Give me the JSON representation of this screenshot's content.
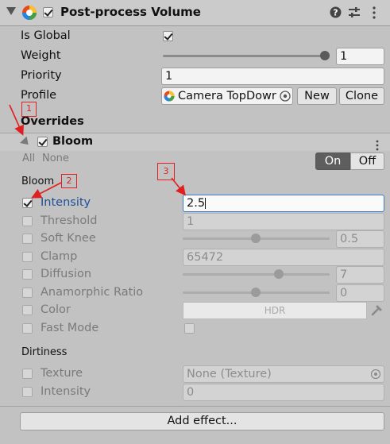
{
  "component": {
    "title": "Post-process Volume",
    "enabled": true
  },
  "fields": {
    "is_global": {
      "label": "Is Global",
      "checked": true
    },
    "weight": {
      "label": "Weight",
      "value": "1",
      "fraction": 1.0
    },
    "priority": {
      "label": "Priority",
      "value": "1"
    },
    "profile": {
      "label": "Profile",
      "value": "Camera TopDowr",
      "new_label": "New",
      "clone_label": "Clone"
    }
  },
  "overrides": {
    "label": "Overrides",
    "effect": {
      "name": "Bloom",
      "enabled": true,
      "all_label": "All",
      "none_label": "None",
      "on_label": "On",
      "off_label": "Off",
      "toggle_state": "On"
    },
    "bloom_section": "Bloom",
    "intensity": {
      "label": "Intensity",
      "value": "2.5",
      "checked": true
    },
    "threshold": {
      "label": "Threshold",
      "value": "1"
    },
    "soft_knee": {
      "label": "Soft Knee",
      "value": "0.5",
      "fraction": 0.5
    },
    "clamp": {
      "label": "Clamp",
      "value": "65472"
    },
    "diffusion": {
      "label": "Diffusion",
      "value": "7",
      "fraction": 0.65
    },
    "anamorphic_ratio": {
      "label": "Anamorphic Ratio",
      "value": "0",
      "fraction": 0.5
    },
    "color": {
      "label": "Color",
      "value": "HDR"
    },
    "fast_mode": {
      "label": "Fast Mode"
    },
    "dirtiness_section": "Dirtiness",
    "texture": {
      "label": "Texture",
      "value": "None (Texture)"
    },
    "dirt_intensity": {
      "label": "Intensity",
      "value": "0"
    }
  },
  "add_effect_label": "Add effect...",
  "annotations": [
    "1",
    "2",
    "3"
  ],
  "colors": {
    "annotation": "#e02020",
    "highlight_text": "#1f4e9b",
    "focus_border": "#3a78c8"
  }
}
